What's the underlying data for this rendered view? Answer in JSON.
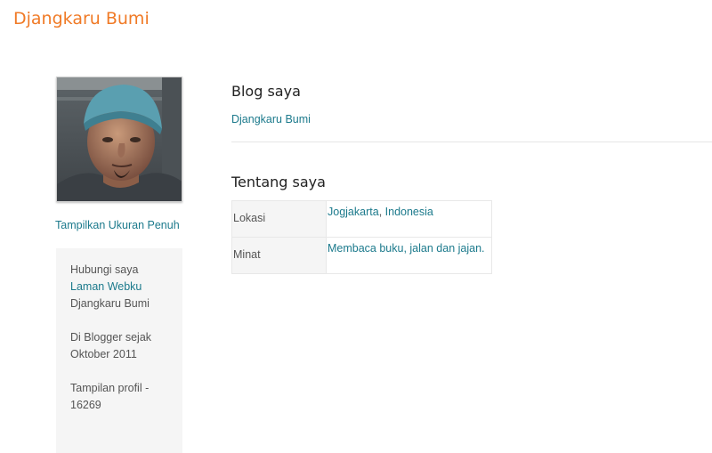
{
  "site": {
    "title": "Djangkaru Bumi"
  },
  "profile": {
    "full_size_link": "Tampilkan Ukuran Penuh",
    "contact": {
      "heading": "Hubungi saya",
      "website_link": "Laman Webku",
      "name": "Djangkaru Bumi",
      "member_since_line1": "Di Blogger sejak",
      "member_since_line2": "Oktober 2011",
      "views_line1": "Tampilan profil -",
      "views_line2": "16269"
    }
  },
  "blogs": {
    "heading": "Blog saya",
    "items": [
      "Djangkaru Bumi"
    ]
  },
  "about": {
    "heading": "Tentang saya",
    "location_label": "Lokasi",
    "location_city": "Jogjakarta",
    "location_separator": ", ",
    "location_country": "Indonesia",
    "interests_label": "Minat",
    "interests_value": "Membaca buku, jalan dan jajan."
  },
  "colors": {
    "title": "#f07a26",
    "link": "#1c7a8c",
    "panel": "#f5f5f5"
  }
}
